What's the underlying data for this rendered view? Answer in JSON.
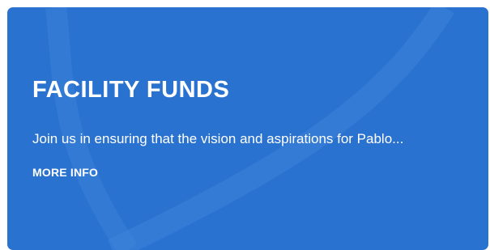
{
  "card": {
    "title": "FACILITY FUNDS",
    "description": "Join us in ensuring that the vision and aspirations for Pablo...",
    "link_label": "MORE INFO"
  },
  "colors": {
    "card_background": "#2a72cf",
    "decorative_curve": "#3b82d8",
    "text": "#ffffff",
    "page_background": "#ffffff"
  }
}
